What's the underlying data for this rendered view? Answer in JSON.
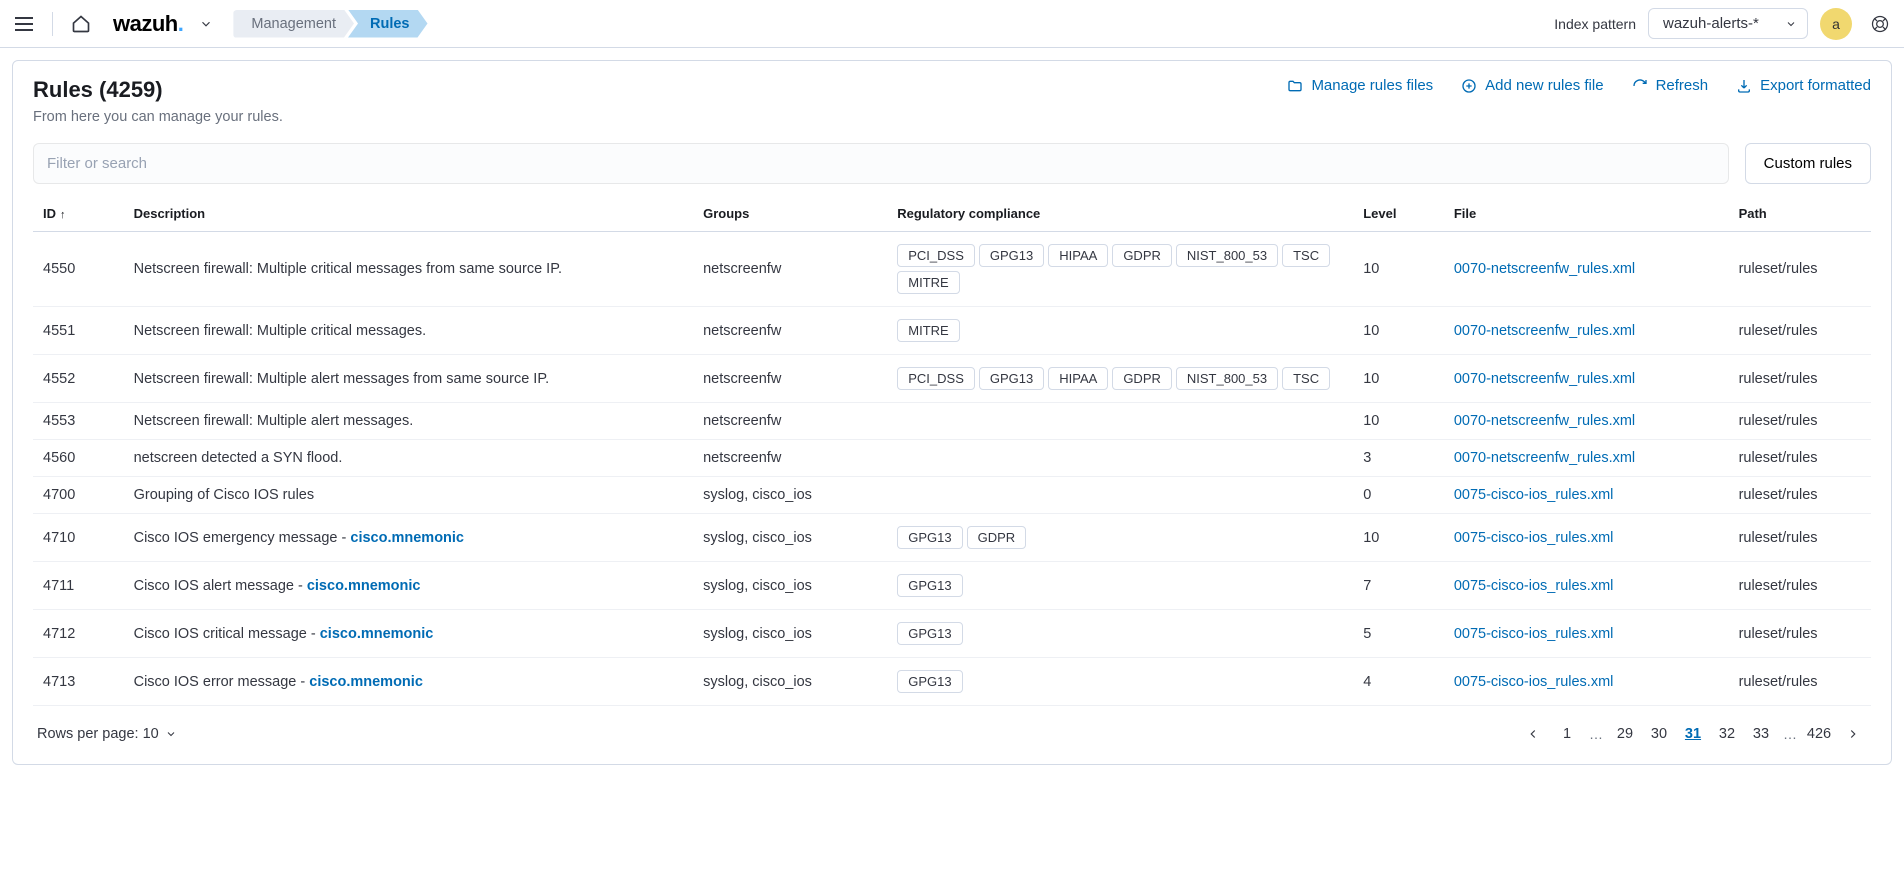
{
  "topbar": {
    "breadcrumb_management": "Management",
    "breadcrumb_rules": "Rules",
    "index_pattern_label": "Index pattern",
    "index_pattern_value": "wazuh-alerts-*",
    "avatar_letter": "a"
  },
  "header": {
    "title": "Rules (4259)",
    "subtitle": "From here you can manage your rules.",
    "action_manage": "Manage rules files",
    "action_add": "Add new rules file",
    "action_refresh": "Refresh",
    "action_export": "Export formatted"
  },
  "filter": {
    "placeholder": "Filter or search",
    "custom_rules_btn": "Custom rules"
  },
  "table": {
    "columns": {
      "id": "ID",
      "description": "Description",
      "groups": "Groups",
      "regulatory": "Regulatory compliance",
      "level": "Level",
      "file": "File",
      "path": "Path"
    },
    "rows": [
      {
        "id": "4550",
        "desc": "Netscreen firewall: Multiple critical messages from same source IP.",
        "mnemonic": "",
        "groups": "netscreenfw",
        "reg": [
          "PCI_DSS",
          "GPG13",
          "HIPAA",
          "GDPR",
          "NIST_800_53",
          "TSC",
          "MITRE"
        ],
        "level": "10",
        "file": "0070-netscreenfw_rules.xml",
        "path": "ruleset/rules"
      },
      {
        "id": "4551",
        "desc": "Netscreen firewall: Multiple critical messages.",
        "mnemonic": "",
        "groups": "netscreenfw",
        "reg": [
          "MITRE"
        ],
        "level": "10",
        "file": "0070-netscreenfw_rules.xml",
        "path": "ruleset/rules"
      },
      {
        "id": "4552",
        "desc": "Netscreen firewall: Multiple alert messages from same source IP.",
        "mnemonic": "",
        "groups": "netscreenfw",
        "reg": [
          "PCI_DSS",
          "GPG13",
          "HIPAA",
          "GDPR",
          "NIST_800_53",
          "TSC"
        ],
        "level": "10",
        "file": "0070-netscreenfw_rules.xml",
        "path": "ruleset/rules"
      },
      {
        "id": "4553",
        "desc": "Netscreen firewall: Multiple alert messages.",
        "mnemonic": "",
        "groups": "netscreenfw",
        "reg": [],
        "level": "10",
        "file": "0070-netscreenfw_rules.xml",
        "path": "ruleset/rules"
      },
      {
        "id": "4560",
        "desc": "netscreen detected a SYN flood.",
        "mnemonic": "",
        "groups": "netscreenfw",
        "reg": [],
        "level": "3",
        "file": "0070-netscreenfw_rules.xml",
        "path": "ruleset/rules"
      },
      {
        "id": "4700",
        "desc": "Grouping of Cisco IOS rules",
        "mnemonic": "",
        "groups": "syslog, cisco_ios",
        "reg": [],
        "level": "0",
        "file": "0075-cisco-ios_rules.xml",
        "path": "ruleset/rules"
      },
      {
        "id": "4710",
        "desc": "Cisco IOS emergency message - ",
        "mnemonic": "cisco.mnemonic",
        "groups": "syslog, cisco_ios",
        "reg": [
          "GPG13",
          "GDPR"
        ],
        "level": "10",
        "file": "0075-cisco-ios_rules.xml",
        "path": "ruleset/rules"
      },
      {
        "id": "4711",
        "desc": "Cisco IOS alert message - ",
        "mnemonic": "cisco.mnemonic",
        "groups": "syslog, cisco_ios",
        "reg": [
          "GPG13"
        ],
        "level": "7",
        "file": "0075-cisco-ios_rules.xml",
        "path": "ruleset/rules"
      },
      {
        "id": "4712",
        "desc": "Cisco IOS critical message - ",
        "mnemonic": "cisco.mnemonic",
        "groups": "syslog, cisco_ios",
        "reg": [
          "GPG13"
        ],
        "level": "5",
        "file": "0075-cisco-ios_rules.xml",
        "path": "ruleset/rules"
      },
      {
        "id": "4713",
        "desc": "Cisco IOS error message - ",
        "mnemonic": "cisco.mnemonic",
        "groups": "syslog, cisco_ios",
        "reg": [
          "GPG13"
        ],
        "level": "4",
        "file": "0075-cisco-ios_rules.xml",
        "path": "ruleset/rules"
      }
    ]
  },
  "footer": {
    "rows_per_page_label": "Rows per page: 10",
    "pages": [
      "1",
      "…",
      "29",
      "30",
      "31",
      "32",
      "33",
      "…",
      "426"
    ],
    "current_page": "31"
  }
}
